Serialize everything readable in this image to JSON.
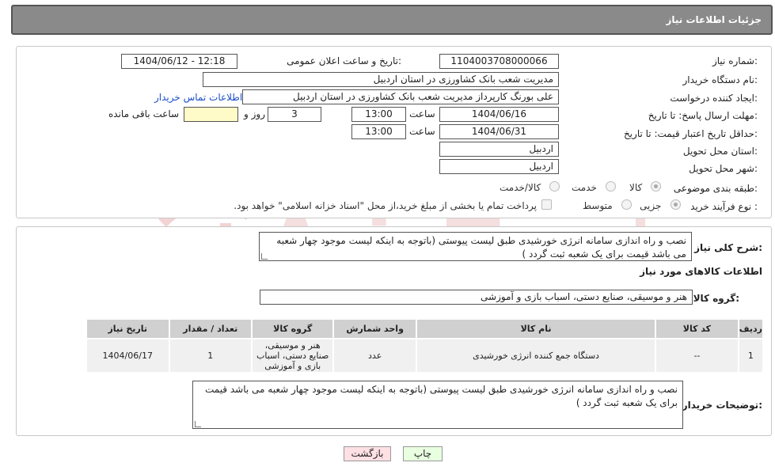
{
  "header": {
    "title": "جزئیات اطلاعات نیاز"
  },
  "form": {
    "need_number": {
      "label": "شماره نیاز:",
      "value": "1104003708000066"
    },
    "announce_datetime": {
      "label": "تاریخ و ساعت اعلان عمومی:",
      "value": "1404/06/12 - 12:18"
    },
    "buyer_org": {
      "label": "نام دستگاه خریدار:",
      "value": "مدیریت شعب بانک کشاورزی در استان اردبیل"
    },
    "requester": {
      "label": "ایجاد کننده درخواست:",
      "value": "علی بورنگ کارپرداز مدیریت شعب بانک کشاورزی در استان اردبیل"
    },
    "contact_link": "اطلاعات تماس خریدار",
    "reply_deadline": {
      "label": "مهلت ارسال پاسخ: تا تاریخ:",
      "date": "1404/06/16",
      "time_label": "ساعت",
      "time": "13:00",
      "days": "3",
      "days_label": "روز و",
      "remaining": "",
      "remaining_label": "ساعت باقی مانده"
    },
    "price_validity": {
      "label": "حداقل تاریخ اعتبار قیمت: تا تاریخ:",
      "date": "1404/06/31",
      "time_label": "ساعت",
      "time": "13:00"
    },
    "province": {
      "label": "استان محل تحویل:",
      "value": "اردبیل"
    },
    "city": {
      "label": "شهر محل تحویل:",
      "value": "اردبیل"
    },
    "category": {
      "label": "طبقه بندی موضوعی:",
      "options": [
        "کالا",
        "خدمت",
        "کالا/خدمت"
      ],
      "selected": "کالا"
    },
    "process_type": {
      "label": "نوع فرآیند خرید :",
      "options": [
        "جزیی",
        "متوسط"
      ],
      "selected": "جزیی",
      "payment_note": "پرداخت تمام یا بخشی از مبلغ خرید،از محل \"اسناد خزانه اسلامی\" خواهد بود."
    }
  },
  "summary": {
    "label": "شرح کلی نیاز:",
    "text": "نصب و راه اندازی سامانه انرژی خورشیدی طبق لیست پیوستی (باتوجه به اینکه لیست موجود چهار شعبه می باشد قیمت برای یک شعبه ثبت گردد )"
  },
  "goods_section": {
    "title": "اطلاعات کالاهای مورد نیاز",
    "group_label": "گروه کالا:",
    "group_value": "هنر و موسیقی، صنایع دستی، اسباب بازی و آموزشی"
  },
  "table": {
    "headers": [
      "ردیف",
      "کد کالا",
      "نام کالا",
      "واحد شمارش",
      "گروه کالا",
      "تعداد / مقدار",
      "تاریخ نیاز"
    ],
    "rows": [
      [
        "1",
        "--",
        "دستگاه جمع کننده انرژی خورشیدی",
        "عدد",
        "هنر و موسیقی، صنایع دستی، اسباب بازی و آموزشی",
        "1",
        "1404/06/17"
      ]
    ]
  },
  "buyer_notes": {
    "label": "توضیحات خریدار:",
    "text": "نصب و راه اندازی سامانه انرژی خورشیدی طبق لیست پیوستی (باتوجه به اینکه لیست موجود چهار شعبه می باشد قیمت برای یک شعبه ثبت گردد )"
  },
  "buttons": {
    "print": "چاپ",
    "back": "بازگشت"
  },
  "watermark_text": "AriaTender.neT",
  "colors": {
    "header_bg": "#8a8a8a",
    "yellow_field": "#fffbc8",
    "print_btn": "#e8ffe0",
    "back_btn": "#ffe0e4"
  }
}
